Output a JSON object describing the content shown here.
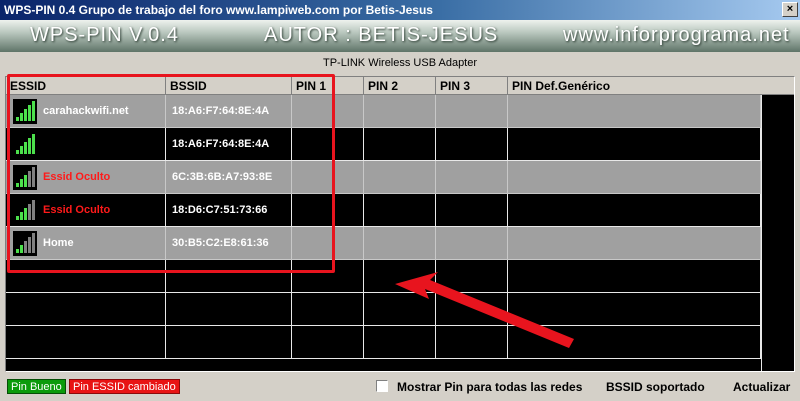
{
  "window": {
    "title": "WPS-PIN 0.4 Grupo de trabajo del foro www.lampiweb.com por Betis-Jesus",
    "close_glyph": "×"
  },
  "banner": {
    "app_name": "WPS-PIN V.0.4",
    "author": "AUTOR : BETIS-JESUS",
    "website": "www.inforprograma.net"
  },
  "adapter": "TP-LINK Wireless USB Adapter",
  "table": {
    "headers": [
      "ESSID",
      "BSSID",
      "PIN 1",
      "PIN 2",
      "PIN 3",
      "PIN Def.Genérico"
    ],
    "rows": [
      {
        "essid": "carahackwifi.net",
        "bssid": "18:A6:F7:64:8E:4A",
        "signal": 5,
        "style": "gray",
        "essid_color": "white"
      },
      {
        "essid": "",
        "bssid": "18:A6:F7:64:8E:4A",
        "signal": 5,
        "style": "black",
        "essid_color": "white"
      },
      {
        "essid": "Essid Oculto",
        "bssid": "6C:3B:6B:A7:93:8E",
        "signal": 3,
        "style": "gray",
        "essid_color": "red"
      },
      {
        "essid": "Essid Oculto",
        "bssid": "18:D6:C7:51:73:66",
        "signal": 3,
        "style": "black",
        "essid_color": "red"
      },
      {
        "essid": "Home",
        "bssid": "30:B5:C2:E8:61:36",
        "signal": 2,
        "style": "gray",
        "essid_color": "white"
      }
    ],
    "signal_icon": "wifi-signal-icon"
  },
  "colors": {
    "highlight": "#e8141e",
    "pin_good": "#0b9b0b",
    "pin_changed": "#e81414",
    "signal_on": "#4ce04c",
    "signal_off": "#808080"
  },
  "status": {
    "legend_good": "Pin Bueno",
    "legend_changed": "Pin ESSID cambiado",
    "show_all_label": "Mostrar Pin para todas las redes",
    "bssid_supported": "BSSID soportado",
    "update": "Actualizar"
  }
}
